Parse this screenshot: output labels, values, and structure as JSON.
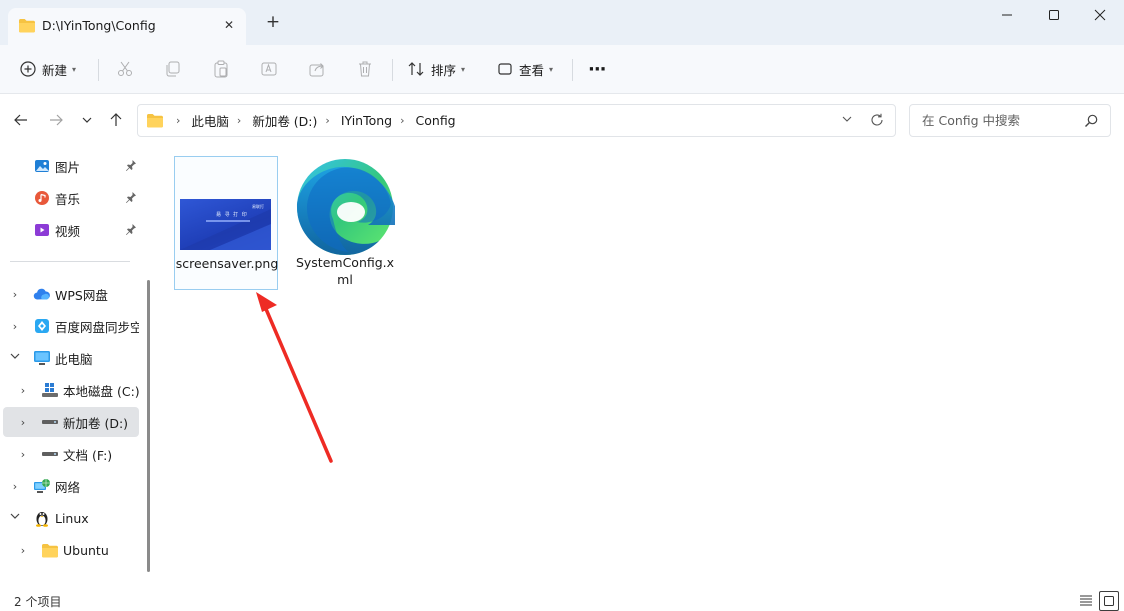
{
  "window": {
    "tab_title": "D:\\IYinTong\\Config",
    "new_tab_symbol": "+",
    "close_tab_symbol": "✕"
  },
  "toolbar": {
    "new_label": "新建",
    "sort_label": "排序",
    "view_label": "查看",
    "more_symbol": "···"
  },
  "breadcrumb": [
    "此电脑",
    "新加卷 (D:)",
    "IYinTong",
    "Config"
  ],
  "search": {
    "placeholder": "在 Config 中搜索"
  },
  "sidebar": {
    "quick_access": [
      {
        "label": "图片",
        "icon": "pictures-icon",
        "color": "#1f7fd6",
        "pinned": true
      },
      {
        "label": "音乐",
        "icon": "music-icon",
        "color": "#e8583a",
        "pinned": true
      },
      {
        "label": "视频",
        "icon": "videos-icon",
        "color": "#8c3bd6",
        "pinned": true
      }
    ],
    "tree": [
      {
        "label": "WPS网盘",
        "icon": "cloud-icon",
        "expander": "›",
        "indent": 0
      },
      {
        "label": "百度网盘同步空",
        "icon": "baidu-sync-icon",
        "expander": "›",
        "indent": 0
      },
      {
        "label": "此电脑",
        "icon": "this-pc-icon",
        "expander": "⌄",
        "indent": 0
      },
      {
        "label": "本地磁盘 (C:)",
        "icon": "windows-drive-icon",
        "expander": "›",
        "indent": 1
      },
      {
        "label": "新加卷 (D:)",
        "icon": "drive-icon",
        "expander": "›",
        "indent": 1,
        "selected": true
      },
      {
        "label": "文档 (F:)",
        "icon": "drive-icon",
        "expander": "›",
        "indent": 1
      },
      {
        "label": "网络",
        "icon": "network-icon",
        "expander": "›",
        "indent": 0
      },
      {
        "label": "Linux",
        "icon": "linux-penguin-icon",
        "expander": "⌄",
        "indent": 0
      },
      {
        "label": "Ubuntu",
        "icon": "folder-icon",
        "expander": "›",
        "indent": 1
      }
    ]
  },
  "files": [
    {
      "name": "screensaver.png",
      "type": "image",
      "selected": true
    },
    {
      "name": "SystemConfig.xml",
      "type": "xml",
      "icon": "edge-icon"
    }
  ],
  "thumbnail_text": {
    "title": "易 寻 打 印",
    "logo": "易联打"
  },
  "annotation": {
    "type": "red-arrow",
    "color": "#ee2b24",
    "points_to": "screensaver.png"
  },
  "status": {
    "item_count": "2 个项目"
  },
  "colors": {
    "accent": "#0067c0",
    "selection_border": "#99cdf0",
    "titlebar_bg": "#eaf0f7"
  }
}
